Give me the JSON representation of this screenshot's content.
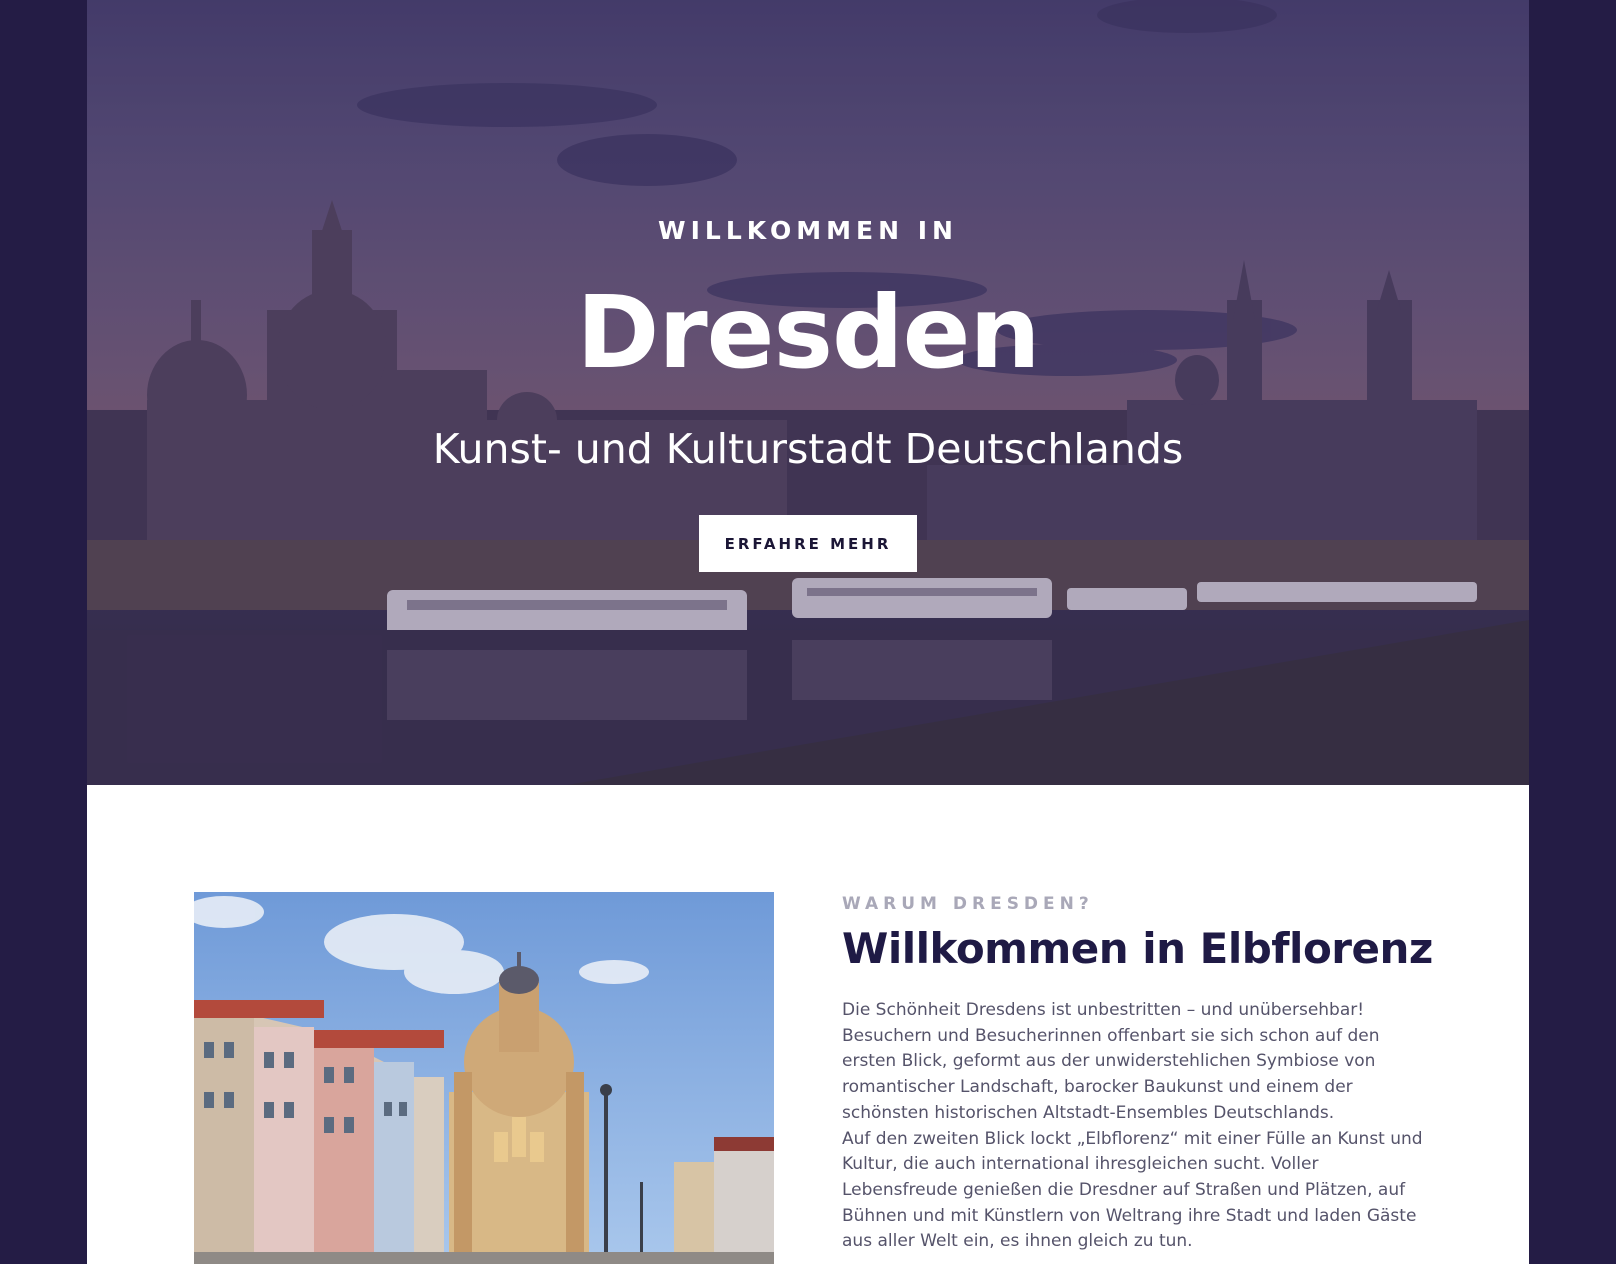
{
  "hero": {
    "kicker": "WILLKOMMEN IN",
    "title": "Dresden",
    "subtitle": "Kunst- und Kulturstadt Deutschlands",
    "cta_label": "ERFAHRE MEHR"
  },
  "intro": {
    "eyebrow": "WARUM DRESDEN?",
    "title": "Willkommen in Elbflorenz",
    "paragraphs": [
      "Die Schönheit Dresdens ist unbestritten – und unübersehbar! Besuchern und Besucherinnen offenbart sie sich schon auf den ersten Blick, geformt aus der unwiderstehlichen Symbiose von romantischer Landschaft, barocker Baukunst und einem der schönsten historischen Altstadt-Ensembles Deutschlands.",
      "Auf den zweiten Blick lockt „Elbflorenz“ mit einer Fülle an Kunst und Kultur, die auch international ihresgleichen sucht. Voller Lebensfreude genießen die Dresdner auf Straßen und Plätzen, auf Bühnen und mit Künstlern von Weltrang ihre Stadt und laden Gäste aus aller Welt ein, es ihnen gleich zu tun."
    ]
  },
  "colors": {
    "page_background": "#241c45",
    "heading": "#1f1a45",
    "eyebrow": "#a9a8b8",
    "body": "#55536a",
    "button_bg": "#ffffff",
    "button_text": "#1b1636"
  }
}
